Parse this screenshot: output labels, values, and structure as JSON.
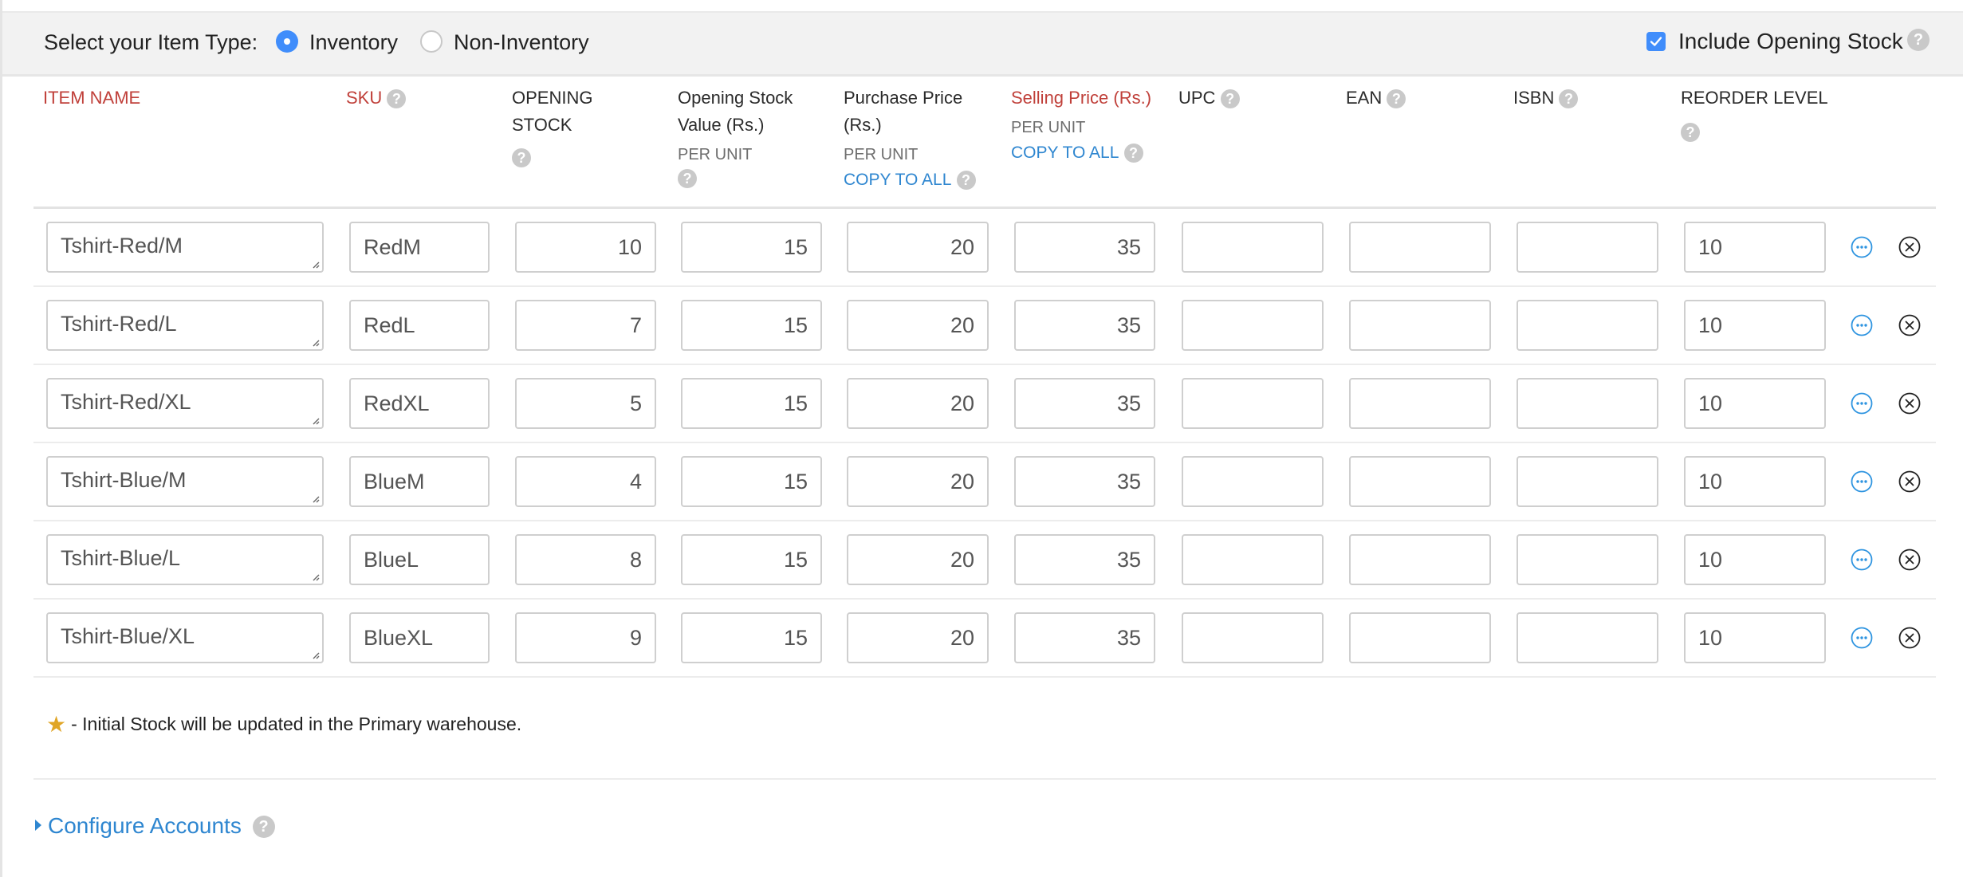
{
  "item_type": {
    "label": "Select your Item Type:",
    "options": [
      {
        "label": "Inventory",
        "selected": true
      },
      {
        "label": "Non-Inventory",
        "selected": false
      }
    ]
  },
  "include_opening_stock": {
    "label": "Include Opening Stock",
    "checked": true
  },
  "columns": {
    "item_name": {
      "label": "ITEM NAME"
    },
    "sku": {
      "label": "SKU"
    },
    "opening_stock": {
      "line1": "OPENING",
      "line2": "STOCK"
    },
    "opening_stock_value": {
      "line1": "Opening Stock",
      "line2": "Value (Rs.)",
      "sub": "PER UNIT"
    },
    "purchase_price": {
      "line1": "Purchase Price",
      "line2": "(Rs.)",
      "sub": "PER UNIT",
      "copy": "COPY TO ALL"
    },
    "selling_price": {
      "line1": "Selling Price (Rs.)",
      "sub": "PER UNIT",
      "copy": "COPY TO ALL"
    },
    "upc": {
      "label": "UPC"
    },
    "ean": {
      "label": "EAN"
    },
    "isbn": {
      "label": "ISBN"
    },
    "reorder_level": {
      "label": "REORDER LEVEL"
    }
  },
  "help_glyph": "?",
  "rows": [
    {
      "name": "Tshirt-Red/M",
      "sku": "RedM",
      "stock": "10",
      "value": "15",
      "purchase": "20",
      "selling": "35",
      "upc": "",
      "ean": "",
      "isbn": "",
      "reorder": "10"
    },
    {
      "name": "Tshirt-Red/L",
      "sku": "RedL",
      "stock": "7",
      "value": "15",
      "purchase": "20",
      "selling": "35",
      "upc": "",
      "ean": "",
      "isbn": "",
      "reorder": "10"
    },
    {
      "name": "Tshirt-Red/XL",
      "sku": "RedXL",
      "stock": "5",
      "value": "15",
      "purchase": "20",
      "selling": "35",
      "upc": "",
      "ean": "",
      "isbn": "",
      "reorder": "10"
    },
    {
      "name": "Tshirt-Blue/M",
      "sku": "BlueM",
      "stock": "4",
      "value": "15",
      "purchase": "20",
      "selling": "35",
      "upc": "",
      "ean": "",
      "isbn": "",
      "reorder": "10"
    },
    {
      "name": "Tshirt-Blue/L",
      "sku": "BlueL",
      "stock": "8",
      "value": "15",
      "purchase": "20",
      "selling": "35",
      "upc": "",
      "ean": "",
      "isbn": "",
      "reorder": "10"
    },
    {
      "name": "Tshirt-Blue/XL",
      "sku": "BlueXL",
      "stock": "9",
      "value": "15",
      "purchase": "20",
      "selling": "35",
      "upc": "",
      "ean": "",
      "isbn": "",
      "reorder": "10"
    }
  ],
  "row_actions": {
    "more_icon": "more-options-icon",
    "remove_icon": "remove-icon"
  },
  "footer": {
    "star_glyph": "★",
    "note": "- Initial Stock will be updated in the Primary warehouse.",
    "configure_accounts": "Configure Accounts"
  },
  "colors": {
    "accent_blue": "#408dfb",
    "link_blue": "#2e86d0",
    "required_red": "#c0403a",
    "star_gold": "#e0a526"
  }
}
